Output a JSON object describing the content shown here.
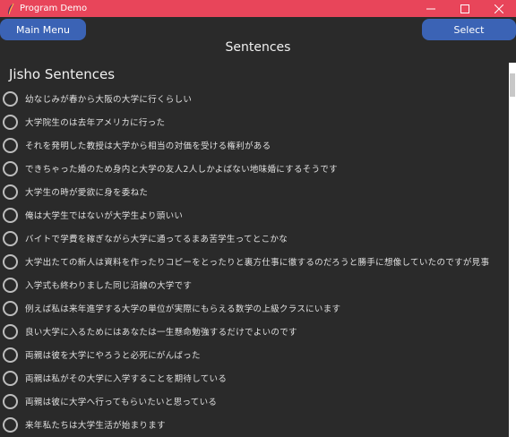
{
  "window": {
    "title": "Program Demo",
    "accent": "#e8455a"
  },
  "toolbar": {
    "main_menu_label": "Main Menu",
    "select_label": "Select",
    "button_color": "#3b63b5"
  },
  "page_title": "Sentences",
  "section_title": "Jisho Sentences",
  "sentences": [
    "幼なじみが春から大阪の大学に行くらしい",
    "大学院生のは去年アメリカに行った",
    "それを発明した教授は大学から相当の対価を受ける権利がある",
    "できちゃった婚のため身内と大学の友人2人しかよばない地味婚にするそうです",
    "大学生の時が愛欲に身を委ねた",
    "俺は大学生ではないが大学生より頭いい",
    "バイトで学費を稼ぎながら大学に通ってるまあ苦学生ってとこかな",
    "大学出たての新人は資料を作ったりコピーをとったりと裏方仕事に徹するのだろうと勝手に想像していたのですが見事",
    "入学式も終わりました同じ沿線の大学です",
    "例えば私は来年進学する大学の単位が実際にもらえる数学の上級クラスにいます",
    "良い大学に入るためにはあなたは一生懸命勉強するだけでよいのです",
    "両親は彼を大学にやろうと必死にがんばった",
    "両親は私がその大学に入学することを期待している",
    "両親は彼に大学へ行ってもらいたいと思っている",
    "来年私たちは大学生活が始まります"
  ]
}
